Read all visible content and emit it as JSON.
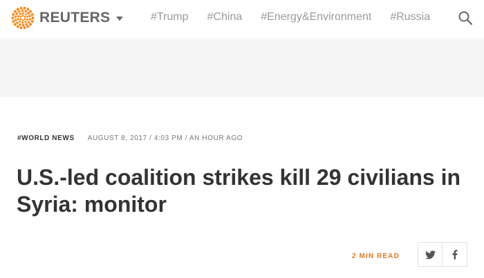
{
  "header": {
    "logo_text": "REUTERS",
    "logo_color": "#ff8000",
    "nav_items": [
      {
        "label": "#Trump"
      },
      {
        "label": "#China"
      },
      {
        "label": "#Energy&Environment"
      },
      {
        "label": "#Russia"
      }
    ]
  },
  "article": {
    "channel": "#WORLD NEWS",
    "dateline": "AUGUST 8, 2017 / 4:03 PM / AN HOUR AGO",
    "headline": "U.S.-led coalition strikes kill 29 civilians in Syria: monitor",
    "read_time": "2 MIN READ",
    "share": [
      {
        "network": "twitter",
        "icon": "twitter-icon"
      },
      {
        "network": "facebook",
        "icon": "facebook-icon"
      }
    ]
  },
  "colors": {
    "accent": "#e4761f",
    "text": "#333333",
    "muted": "#9a9a9a",
    "band": "#f5f5f5"
  }
}
